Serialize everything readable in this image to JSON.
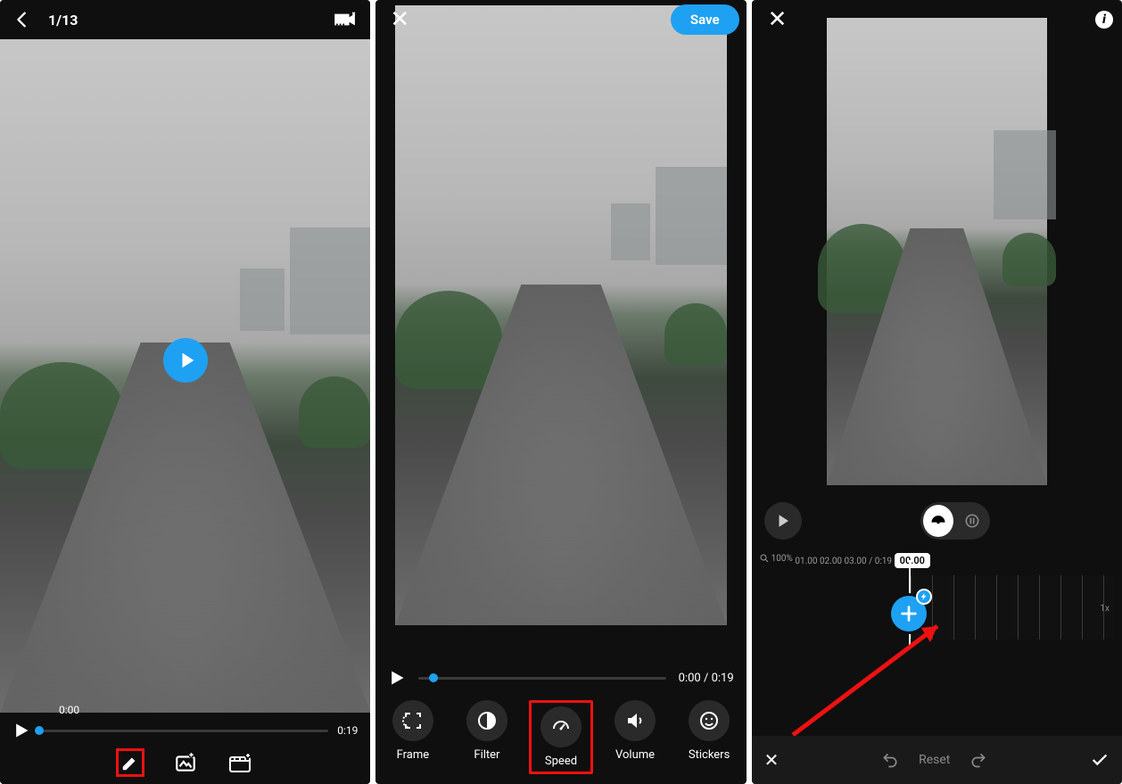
{
  "panel1": {
    "counter": "1/13",
    "current_time": "0:00",
    "duration": "0:19"
  },
  "panel2": {
    "save_label": "Save",
    "current_time": "0:00",
    "duration": "0:19",
    "tools": {
      "frame": "Frame",
      "filter": "Filter",
      "speed": "Speed",
      "volume": "Volume",
      "stickers": "Stickers"
    }
  },
  "panel3": {
    "zoom": "100%",
    "cursor_time": "00.00",
    "tick1": "01.00",
    "tick2": "02.00",
    "tick3": "03.00",
    "total": "0:19",
    "speed_label": "1x",
    "reset_label": "Reset"
  }
}
